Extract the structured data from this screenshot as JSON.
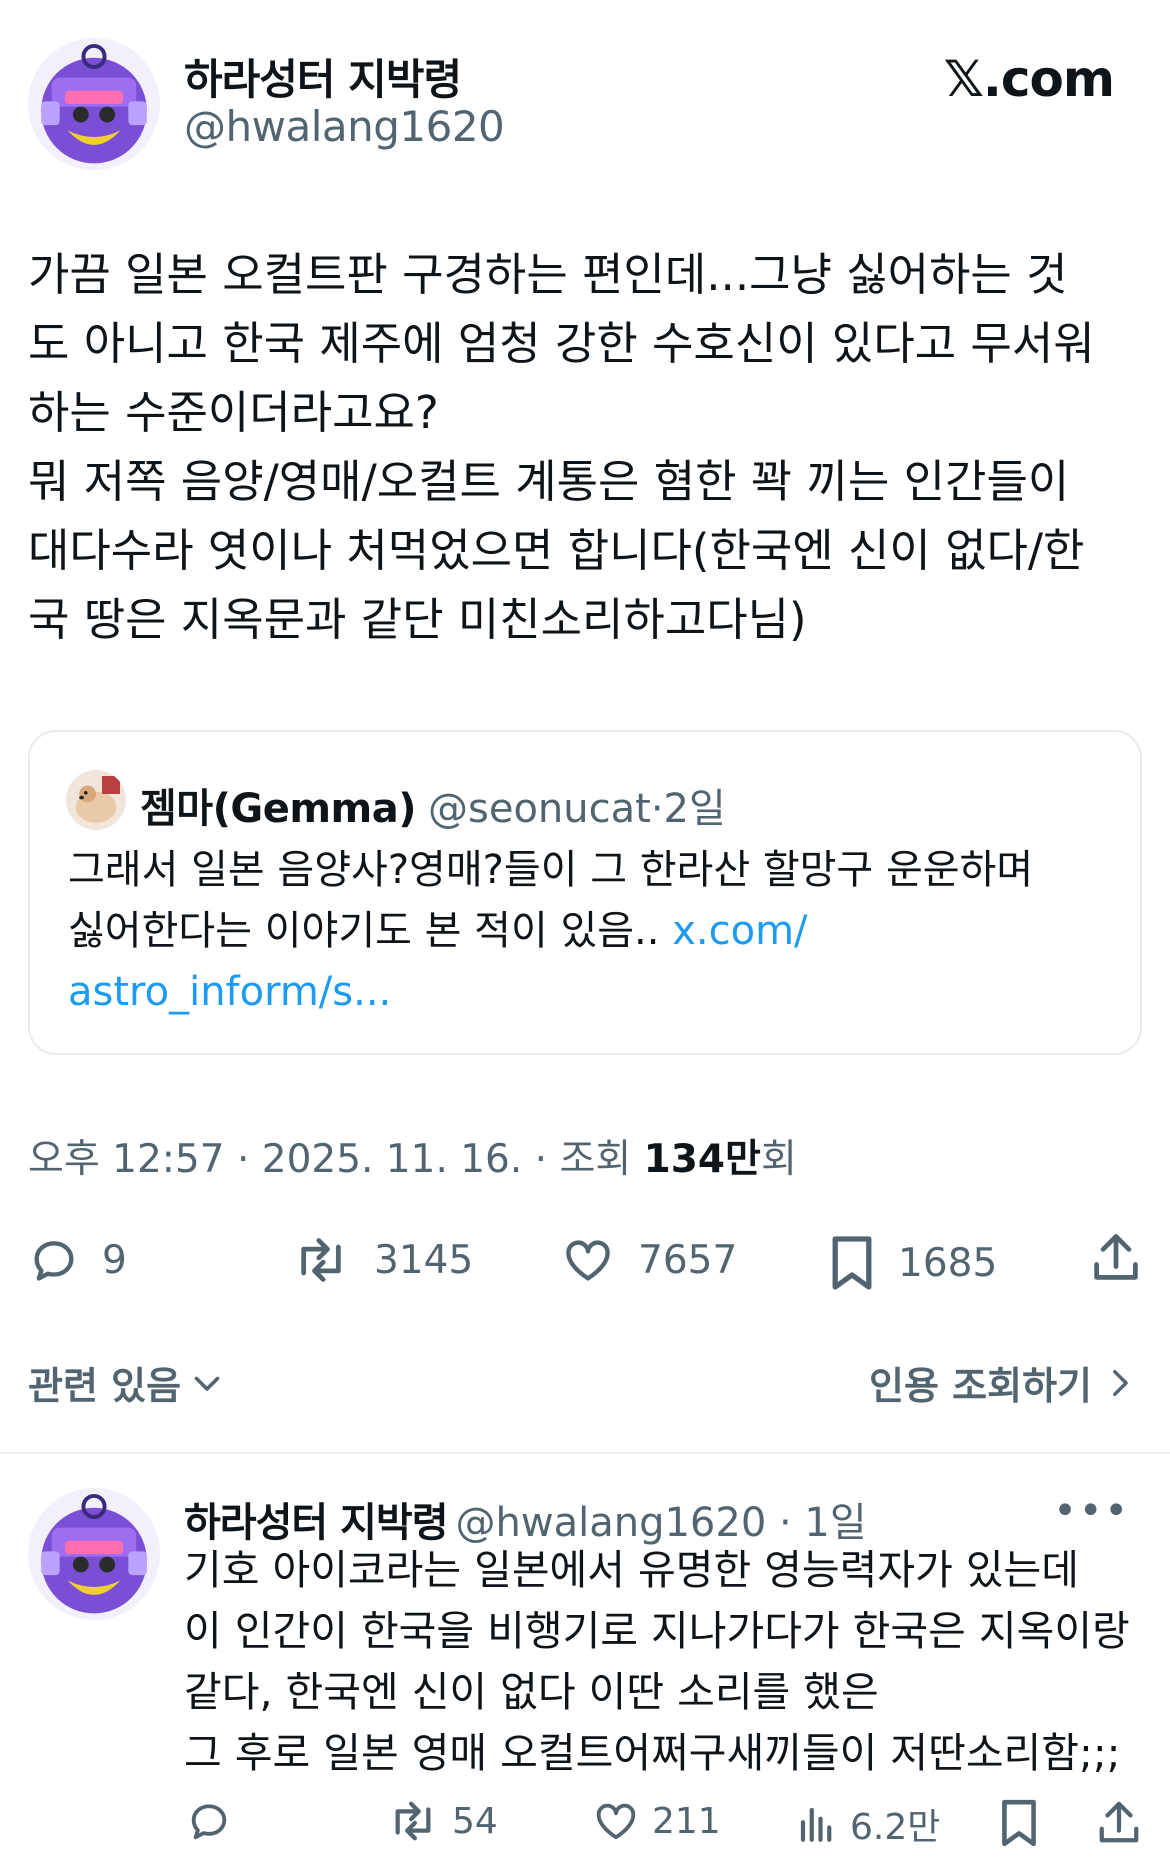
{
  "brand": "𝕏.com",
  "author": {
    "display_name": "하라성터 지박령",
    "handle": "@hwalang1620"
  },
  "tweet": {
    "lines": [
      "가끔 일본 오컬트판 구경하는 편인데...그냥 싫어하는 것",
      "도 아니고 한국 제주에 엄청 강한 수호신이 있다고 무서워",
      "하는 수준이더라고요?",
      "뭐 저쪽 음양/영매/오컬트 계통은 혐한 꽉 끼는 인간들이",
      "대다수라 엿이나 처먹었으면 합니다(한국엔 신이 없다/한",
      "국 땅은 지옥문과 같단 미친소리하고다님)"
    ]
  },
  "quote": {
    "display_name": "젬마(Gemma)",
    "handle": "@seonucat",
    "separator": "·",
    "age": "2일",
    "line1": "그래서 일본 음양사?영매?들이 그 한라산 할망구 운운하며",
    "line2_text": "싫어한다는 이야기도 본 적이 있음.. ",
    "line2_link": "x.com/",
    "line3_link": "astro_inform/s..."
  },
  "meta": {
    "time": "오후 12:57",
    "sep": " · ",
    "date": "2025. 11. 16.",
    "views_label": "조회 ",
    "views_count": "134만",
    "views_suffix": "회"
  },
  "actions": {
    "replies": "9",
    "retweets": "3145",
    "likes": "7657",
    "bookmarks": "1685"
  },
  "links": {
    "related": "관련 있음",
    "quote_views": "인용 조회하기"
  },
  "reply": {
    "display_name": "하라성터 지박령",
    "handle_age": "@hwalang1620 · 1일",
    "more": "•••",
    "lines": [
      "기호 아이코라는 일본에서 유명한 영능력자가 있는데",
      "이 인간이 한국을 비행기로 지나가다가 한국은 지옥이랑",
      "같다, 한국엔 신이 없다 이딴 소리를 했은",
      "그 후로 일본 영매 오컬트어쩌구새끼들이 저딴소리함;;;"
    ],
    "actions": {
      "retweets": "54",
      "likes": "211",
      "views": "6.2만"
    }
  },
  "colors": {
    "text": "#0f1419",
    "secondary": "#536471",
    "link": "#1d9bf0",
    "border": "#e6ecf0"
  }
}
